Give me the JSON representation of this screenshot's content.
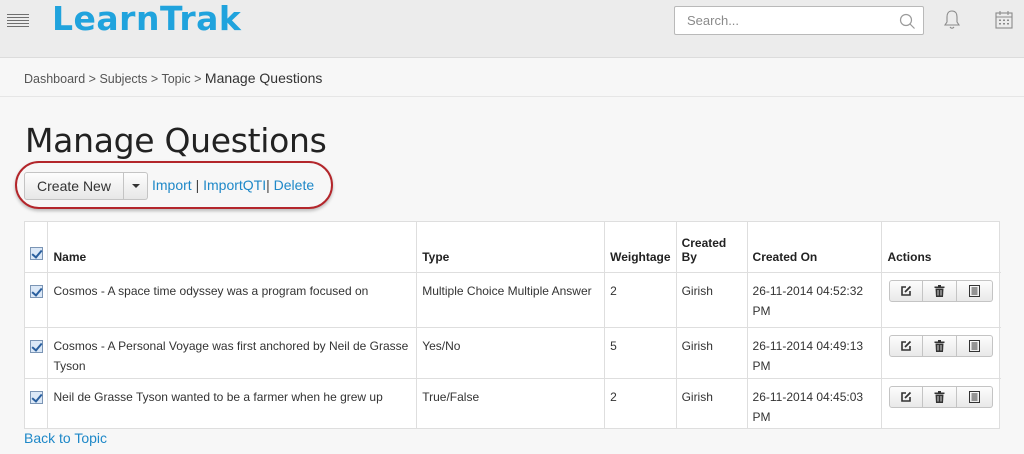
{
  "header": {
    "logo": "LearnTrak",
    "search_placeholder": "Search...",
    "icons": [
      "menu-icon",
      "search-icon",
      "bell-icon",
      "calendar-icon"
    ]
  },
  "breadcrumb": {
    "items": [
      "Dashboard",
      "Subjects",
      "Topic"
    ],
    "separator": ">",
    "current": "Manage Questions"
  },
  "page_title": "Manage Questions",
  "toolbar": {
    "create_new_label": "Create New",
    "import_label": "Import",
    "import_qti_label": "ImportQTI",
    "delete_label": "Delete",
    "separator": "|"
  },
  "table": {
    "headers": {
      "name": "Name",
      "type": "Type",
      "weightage": "Weightage",
      "created_by": "Created By",
      "created_on": "Created On",
      "actions": "Actions"
    },
    "rows": [
      {
        "checked": true,
        "name": "Cosmos - A space time odyssey was a program focused on",
        "type": "Multiple Choice Multiple Answer",
        "weightage": "2",
        "created_by": "Girish",
        "created_on": "26-11-2014 04:52:32 PM"
      },
      {
        "checked": true,
        "name": "Cosmos - A Personal Voyage was first anchored by Neil de Grasse Tyson",
        "type": "Yes/No",
        "weightage": "5",
        "created_by": "Girish",
        "created_on": "26-11-2014 04:49:13 PM"
      },
      {
        "checked": true,
        "name": "Neil de Grasse Tyson wanted to be a farmer when he grew up",
        "type": "True/False",
        "weightage": "2",
        "created_by": "Girish",
        "created_on": "26-11-2014 04:45:03 PM"
      }
    ],
    "row_action_icons": [
      "edit-icon",
      "trash-icon",
      "details-icon"
    ]
  },
  "footer_link": "Back to Topic",
  "colors": {
    "brand": "#20a3dd",
    "link": "#1e88c8",
    "highlight_outline": "#b3262b"
  }
}
